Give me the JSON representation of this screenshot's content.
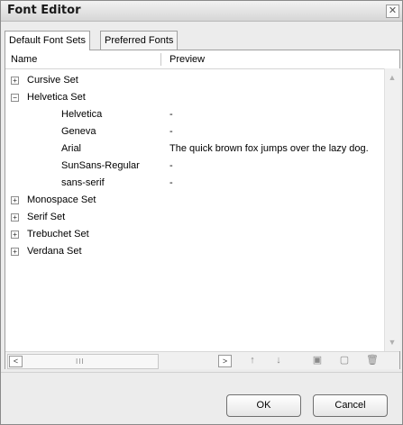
{
  "window": {
    "title": "Font Editor",
    "close_icon": "close-icon"
  },
  "tabs": [
    {
      "label": "Default Font Sets",
      "active": true
    },
    {
      "label": "Preferred Fonts",
      "active": false
    }
  ],
  "columns": {
    "name": "Name",
    "preview": "Preview"
  },
  "rows": [
    {
      "label": "Cursive Set",
      "preview": "",
      "expander": "+"
    },
    {
      "label": "Helvetica Set",
      "preview": "",
      "expander": "−"
    },
    {
      "label": "Helvetica",
      "preview": "-",
      "expander": ""
    },
    {
      "label": "Geneva",
      "preview": "-",
      "expander": ""
    },
    {
      "label": "Arial",
      "preview": "The quick brown fox jumps over the lazy dog.",
      "expander": ""
    },
    {
      "label": "SunSans-Regular",
      "preview": "-",
      "expander": ""
    },
    {
      "label": "sans-serif",
      "preview": "-",
      "expander": ""
    },
    {
      "label": "Monospace Set",
      "preview": "",
      "expander": "+"
    },
    {
      "label": "Serif Set",
      "preview": "",
      "expander": "+"
    },
    {
      "label": "Trebuchet Set",
      "preview": "",
      "expander": "+"
    },
    {
      "label": "Verdana Set",
      "preview": "",
      "expander": "+"
    }
  ],
  "toolbar": {
    "scroll_left": "<",
    "scroll_grip": "III",
    "add_font": ">",
    "move_up": "↑",
    "move_down": "↓",
    "new_set": "▣",
    "new_font": "▢",
    "delete": "🗑"
  },
  "buttons": {
    "ok": "OK",
    "cancel": "Cancel"
  }
}
